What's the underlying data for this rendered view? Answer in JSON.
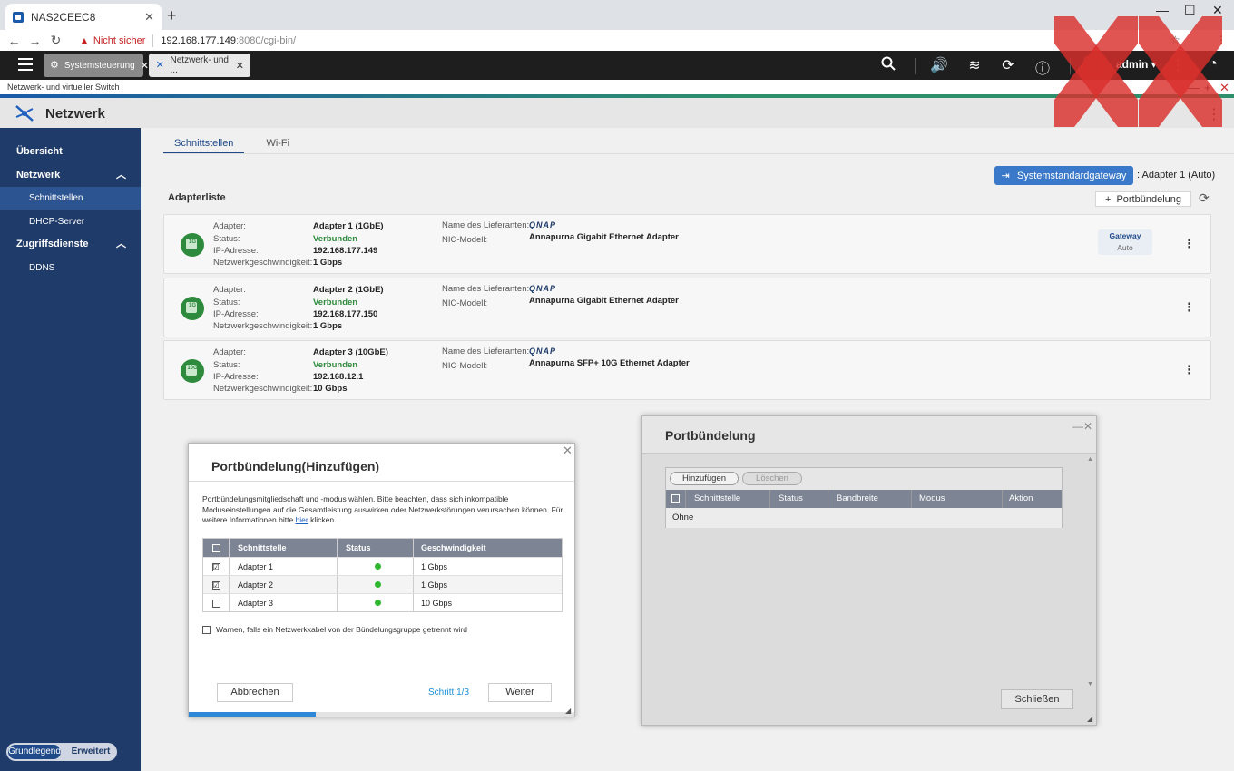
{
  "browser": {
    "tab_title": "NAS2CEEC8",
    "security_label": "Nicht sicher",
    "url_host": "192.168.177.149",
    "url_path": ":8080/cgi-bin/"
  },
  "qts": {
    "tabs": [
      {
        "label": "Systemsteuerung"
      },
      {
        "label": "Netzwerk- und ..."
      }
    ],
    "user": "admin ▾"
  },
  "window_strip": {
    "title": "Netzwerk- und virtueller Switch"
  },
  "app": {
    "title": "Netzwerk"
  },
  "sidebar": {
    "items": [
      {
        "label": "Übersicht"
      },
      {
        "label": "Netzwerk"
      },
      {
        "label": "Schnittstellen"
      },
      {
        "label": "DHCP-Server"
      },
      {
        "label": "Zugriffsdienste"
      },
      {
        "label": "DDNS"
      }
    ],
    "mode": {
      "basic": "Grundlegend",
      "advanced": "Erweitert"
    }
  },
  "main": {
    "tabs": [
      {
        "label": "Schnittstellen"
      },
      {
        "label": "Wi-Fi"
      }
    ],
    "gateway_button": "Systemstandardgateway",
    "gateway_value": ": Adapter 1 (Auto)",
    "portbundle_button": "Portbündelung",
    "list_title": "Adapterliste",
    "labels": {
      "adapter": "Adapter:",
      "status": "Status:",
      "ip": "IP-Adresse:",
      "speed": "Netzwerkgeschwindigkeit:",
      "vendor": "Name des Lieferanten:",
      "nic": "NIC-Modell:"
    },
    "vendor_logo": "QNAP",
    "gateway_badge": {
      "title": "Gateway",
      "sub": "Auto"
    },
    "adapters": [
      {
        "badge": "1G",
        "name": "Adapter 1 (1GbE)",
        "status": "Verbunden",
        "ip": "192.168.177.149",
        "speed": "1 Gbps",
        "nic": "Annapurna Gigabit Ethernet Adapter"
      },
      {
        "badge": "1G",
        "name": "Adapter 2 (1GbE)",
        "status": "Verbunden",
        "ip": "192.168.177.150",
        "speed": "1 Gbps",
        "nic": "Annapurna Gigabit Ethernet Adapter"
      },
      {
        "badge": "10G",
        "name": "Adapter 3 (10GbE)",
        "status": "Verbunden",
        "ip": "192.168.12.1",
        "speed": "10 Gbps",
        "nic": "Annapurna SFP+ 10G Ethernet Adapter"
      }
    ]
  },
  "portwin": {
    "title": "Portbündelung",
    "add_button": "Hinzufügen",
    "delete_button": "Löschen",
    "columns": [
      "Schnittstelle",
      "Status",
      "Bandbreite",
      "Modus",
      "Aktion"
    ],
    "empty_row": "Ohne",
    "close_button": "Schließen"
  },
  "dialog": {
    "title": "Portbündelung(Hinzufügen)",
    "desc_1": "Portbündelungsmitgliedschaft und -modus wählen. Bitte beachten, dass sich inkompatible Moduseinstellungen auf die Gesamtleistung auswirken oder Netzwerkstörungen verursachen können. Für weitere Informationen bitte ",
    "desc_link": "hier",
    "desc_2": " klicken.",
    "columns": [
      "Schnittstelle",
      "Status",
      "Geschwindigkeit"
    ],
    "rows": [
      {
        "name": "Adapter 1",
        "speed": "1 Gbps",
        "checked": "☑"
      },
      {
        "name": "Adapter 2",
        "speed": "1 Gbps",
        "checked": "☑"
      },
      {
        "name": "Adapter 3",
        "speed": "10 Gbps",
        "checked": ""
      }
    ],
    "warn_label": "Warnen, falls ein Netzwerkkabel von der Bündelungsgruppe getrennt wird",
    "cancel_button": "Abbrechen",
    "step": "Schritt 1/3",
    "next_button": "Weiter",
    "progress": 0.33
  },
  "colors": {
    "sidebar": "#1f3b6a",
    "accent": "#3a78c9",
    "connected": "#2e8b3d",
    "overlay": "#d9302c"
  }
}
